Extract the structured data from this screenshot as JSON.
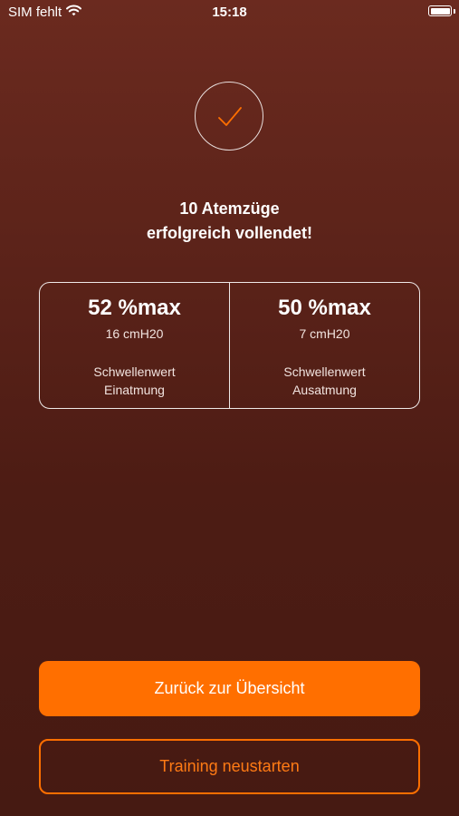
{
  "status_bar": {
    "carrier": "SIM fehlt",
    "time": "15:18",
    "wifi_icon": "wifi-icon",
    "battery_icon": "battery-icon"
  },
  "result": {
    "icon": "checkmark-icon",
    "line1": "10 Atemzüge",
    "line2": "erfolgreich vollendet!"
  },
  "stats": [
    {
      "value": "52 %max",
      "pressure": "16 cmH20",
      "label_line1": "Schwellenwert",
      "label_line2": "Einatmung"
    },
    {
      "value": "50 %max",
      "pressure": "7 cmH20",
      "label_line1": "Schwellenwert",
      "label_line2": "Ausatmung"
    }
  ],
  "buttons": {
    "back_label": "Zurück zur Übersicht",
    "restart_label": "Training neustarten"
  },
  "colors": {
    "accent": "#ff6f00",
    "background_top": "#6b2a1f",
    "background_bottom": "#461a12"
  }
}
